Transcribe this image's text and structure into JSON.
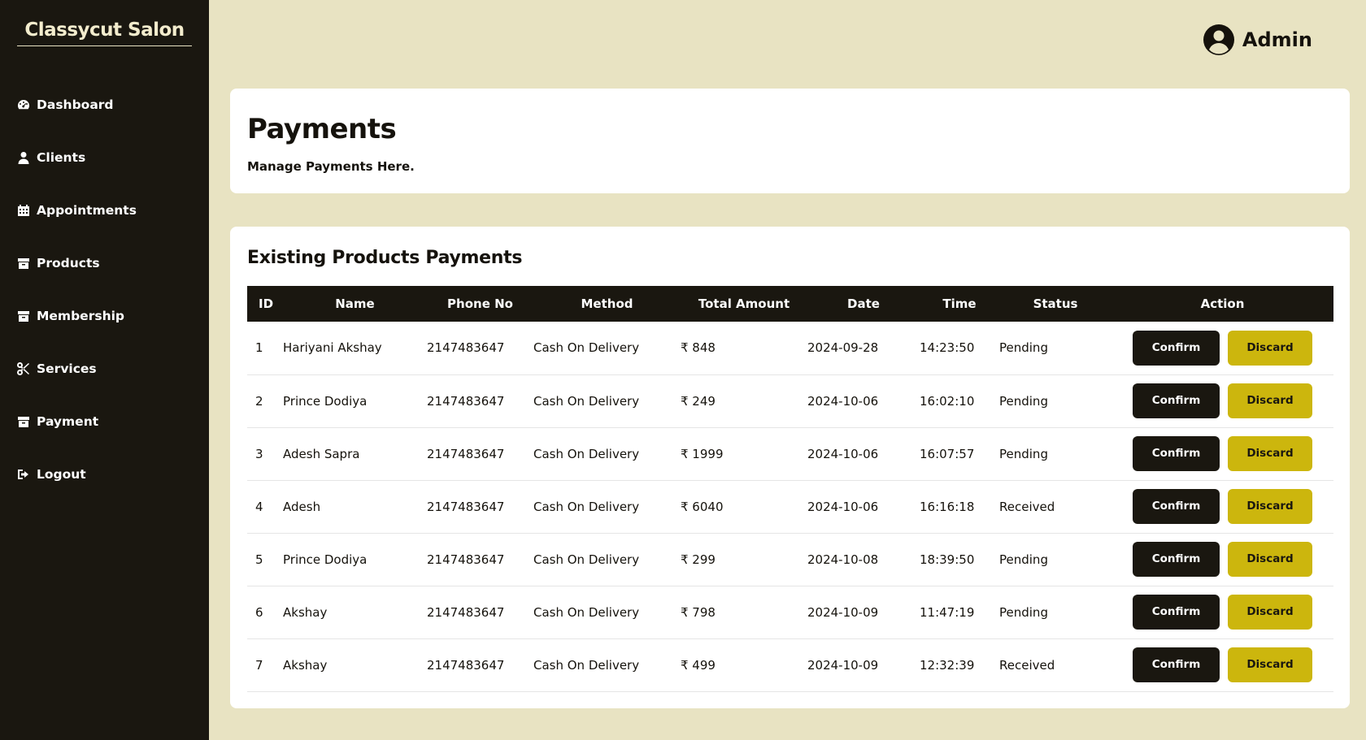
{
  "brand": "Classycut Salon",
  "nav": [
    {
      "label": "Dashboard",
      "icon": "gauge-icon"
    },
    {
      "label": "Clients",
      "icon": "user-icon"
    },
    {
      "label": "Appointments",
      "icon": "calendar-icon"
    },
    {
      "label": "Products",
      "icon": "box-icon"
    },
    {
      "label": "Membership",
      "icon": "box-icon"
    },
    {
      "label": "Services",
      "icon": "scissors-icon"
    },
    {
      "label": "Payment",
      "icon": "box-icon"
    },
    {
      "label": "Logout",
      "icon": "logout-icon"
    }
  ],
  "user": {
    "name": "Admin",
    "icon": "user-circle-icon"
  },
  "header": {
    "title": "Payments",
    "subtitle": "Manage Payments Here."
  },
  "table": {
    "title": "Existing Products Payments",
    "columns": [
      "ID",
      "Name",
      "Phone No",
      "Method",
      "Total Amount",
      "Date",
      "Time",
      "Status",
      "Action"
    ],
    "rows": [
      {
        "id": "1",
        "name": "Hariyani Akshay",
        "phone": "2147483647",
        "method": "Cash On Delivery",
        "amount": "₹ 848",
        "date": "2024-09-28",
        "time": "14:23:50",
        "status": "Pending"
      },
      {
        "id": "2",
        "name": "Prince Dodiya",
        "phone": "2147483647",
        "method": "Cash On Delivery",
        "amount": "₹ 249",
        "date": "2024-10-06",
        "time": "16:02:10",
        "status": "Pending"
      },
      {
        "id": "3",
        "name": "Adesh Sapra",
        "phone": "2147483647",
        "method": "Cash On Delivery",
        "amount": "₹ 1999",
        "date": "2024-10-06",
        "time": "16:07:57",
        "status": "Pending"
      },
      {
        "id": "4",
        "name": "Adesh",
        "phone": "2147483647",
        "method": "Cash On Delivery",
        "amount": "₹ 6040",
        "date": "2024-10-06",
        "time": "16:16:18",
        "status": "Received"
      },
      {
        "id": "5",
        "name": "Prince Dodiya",
        "phone": "2147483647",
        "method": "Cash On Delivery",
        "amount": "₹ 299",
        "date": "2024-10-08",
        "time": "18:39:50",
        "status": "Pending"
      },
      {
        "id": "6",
        "name": "Akshay",
        "phone": "2147483647",
        "method": "Cash On Delivery",
        "amount": "₹ 798",
        "date": "2024-10-09",
        "time": "11:47:19",
        "status": "Pending"
      },
      {
        "id": "7",
        "name": "Akshay",
        "phone": "2147483647",
        "method": "Cash On Delivery",
        "amount": "₹ 499",
        "date": "2024-10-09",
        "time": "12:32:39",
        "status": "Received"
      }
    ],
    "confirm_label": "Confirm",
    "discard_label": "Discard"
  },
  "colors": {
    "sidebar": "#1a1710",
    "background": "#e8e3c2",
    "accent": "#ccb60d"
  }
}
